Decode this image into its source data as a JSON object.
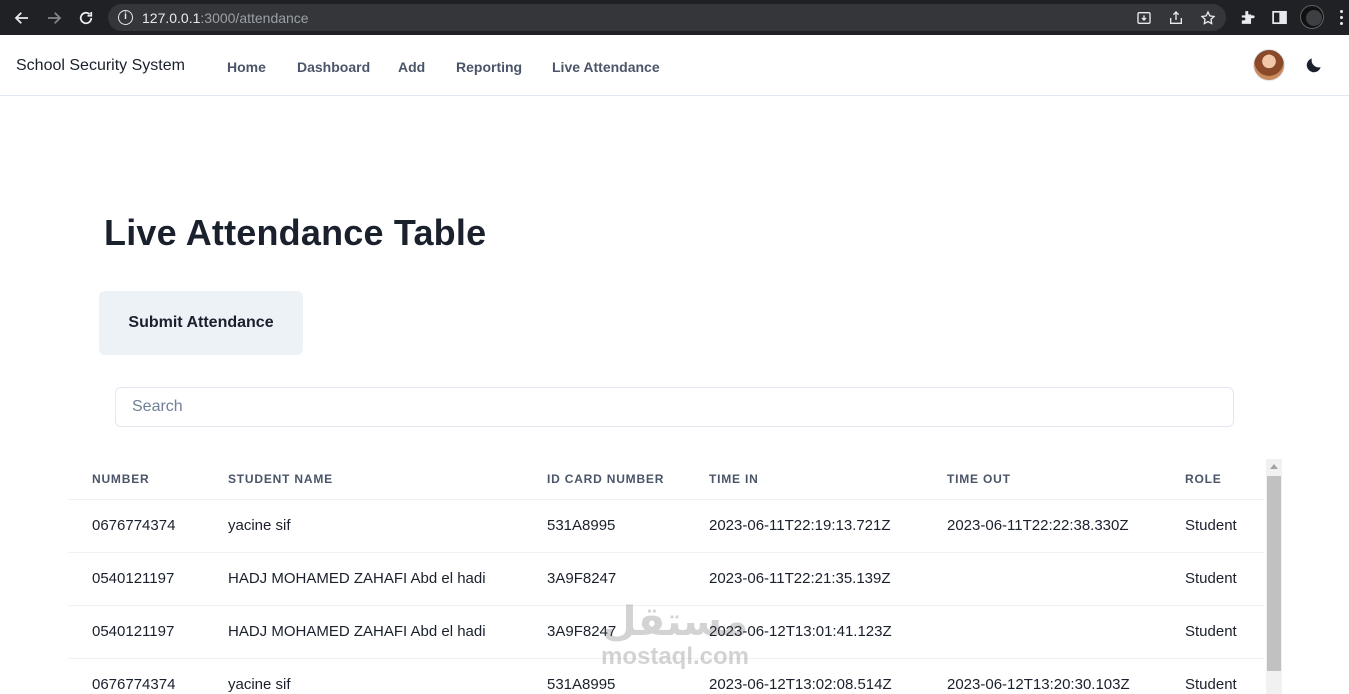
{
  "browser": {
    "url_host": "127.0.0.1",
    "url_path": ":3000/attendance"
  },
  "navbar": {
    "brand": "School Security System",
    "links": [
      "Home",
      "Dashboard",
      "Add",
      "Reporting",
      "Live Attendance"
    ]
  },
  "page": {
    "title": "Live Attendance Table",
    "submit_label": "Submit Attendance",
    "search_placeholder": "Search"
  },
  "table": {
    "headers": [
      "NUMBER",
      "STUDENT NAME",
      "ID CARD NUMBER",
      "TIME IN",
      "TIME OUT",
      "ROLE"
    ],
    "rows": [
      [
        "0676774374",
        "yacine sif",
        "531A8995",
        "2023-06-11T22:19:13.721Z",
        "2023-06-11T22:22:38.330Z",
        "Student"
      ],
      [
        "0540121197",
        "HADJ MOHAMED ZAHAFI Abd el hadi",
        "3A9F8247",
        "2023-06-11T22:21:35.139Z",
        "",
        "Student"
      ],
      [
        "0540121197",
        "HADJ MOHAMED ZAHAFI Abd el hadi",
        "3A9F8247",
        "2023-06-12T13:01:41.123Z",
        "",
        "Student"
      ],
      [
        "0676774374",
        "yacine sif",
        "531A8995",
        "2023-06-12T13:02:08.514Z",
        "2023-06-12T13:20:30.103Z",
        "Student"
      ]
    ]
  },
  "watermark": {
    "arabic": "مستقل",
    "latin": "mostaql.com"
  },
  "icons": {
    "back": "back-arrow-icon",
    "forward": "forward-arrow-icon",
    "reload": "reload-icon",
    "info": "site-info-icon",
    "install": "install-app-icon",
    "share": "share-icon",
    "bookmark": "star-icon",
    "extensions": "puzzle-icon",
    "sidepanel": "side-panel-icon",
    "theme": "moon-icon"
  }
}
